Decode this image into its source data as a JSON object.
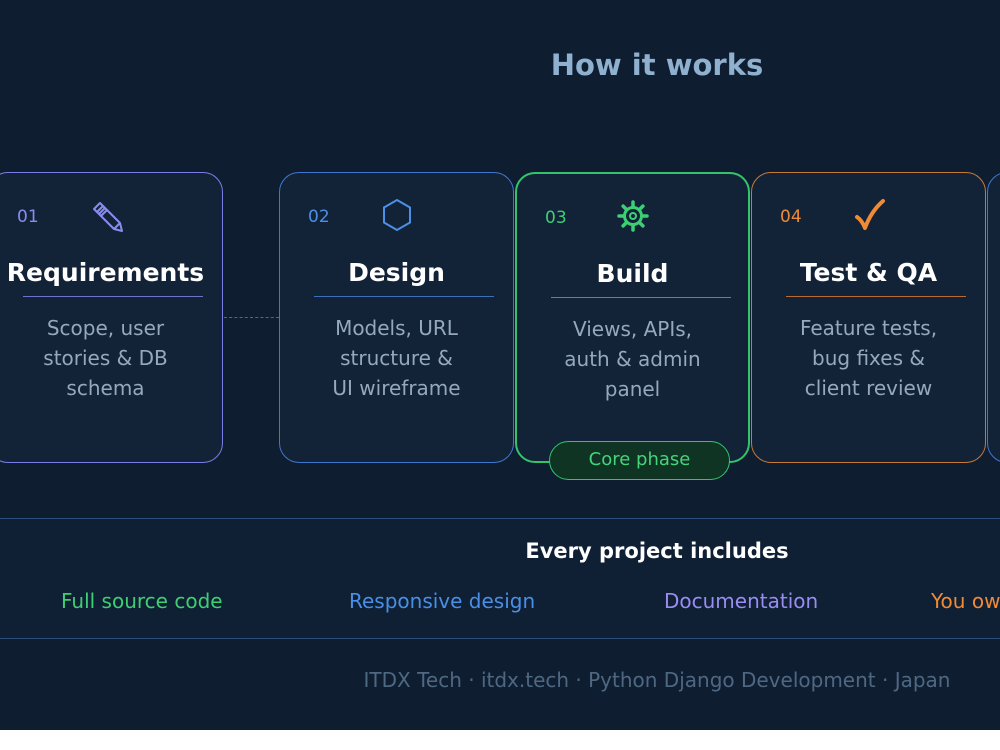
{
  "title": "How it works",
  "steps": [
    {
      "number": "01",
      "icon": "pencil-icon",
      "name": "Requirements",
      "description": "Scope, user\nstories & DB\nschema"
    },
    {
      "number": "02",
      "icon": "hexagon-icon",
      "name": "Design",
      "description": "Models, URL\nstructure &\nUI wireframe"
    },
    {
      "number": "03",
      "icon": "gear-icon",
      "name": "Build",
      "description": "Views, APIs,\nauth & admin\npanel",
      "badge": "Core phase"
    },
    {
      "number": "04",
      "icon": "checkmark-icon",
      "name": "Test & QA",
      "description": "Feature tests,\nbug fixes &\nclient review"
    }
  ],
  "includes": {
    "title": "Every project includes",
    "items": [
      "Full source code",
      "Responsive design",
      "Documentation",
      "You ow"
    ]
  },
  "footer": "ITDX Tech · itdx.tech · Python Django Development · Japan",
  "colors": {
    "background": "#0f1d31",
    "step1": "#7b7de8",
    "step2": "#3f77d0",
    "step3": "#33c46b",
    "step4": "#f08a35"
  }
}
